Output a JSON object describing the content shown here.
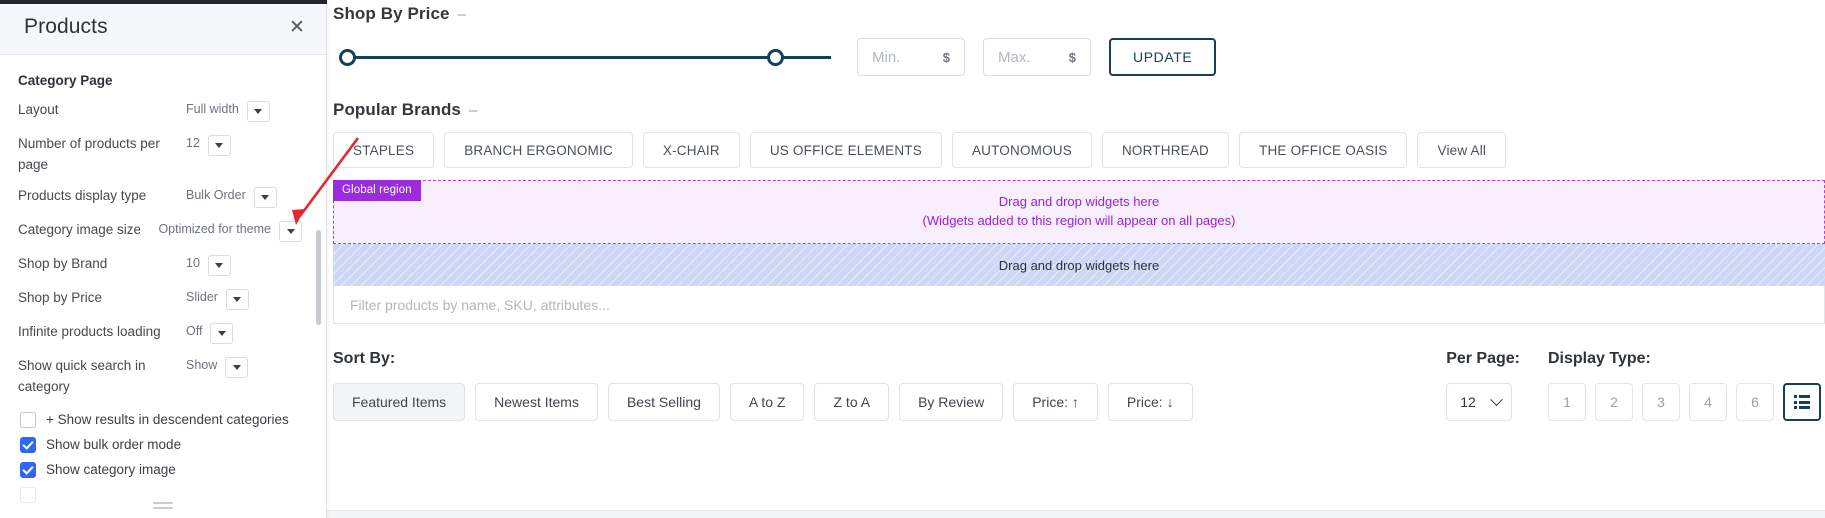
{
  "panel": {
    "title": "Products",
    "close_icon": "close-icon",
    "section_label": "Category Page",
    "settings": [
      {
        "name": "Layout",
        "value": "Full width"
      },
      {
        "name": "Number of products per page",
        "value": "12"
      },
      {
        "name": "Products display type",
        "value": "Bulk Order"
      },
      {
        "name": "Category image size",
        "value": "Optimized for theme"
      },
      {
        "name": "Shop by Brand",
        "value": "10"
      },
      {
        "name": "Shop by Price",
        "value": "Slider"
      },
      {
        "name": "Infinite products loading",
        "value": "Off"
      },
      {
        "name": "Show quick search in category",
        "value": "Show"
      }
    ],
    "checkboxes": [
      {
        "label": "+ Show results in descendent categories",
        "checked": false
      },
      {
        "label": "Show bulk order mode",
        "checked": true
      },
      {
        "label": "Show category image",
        "checked": true
      }
    ]
  },
  "shop_by_price": {
    "title": "Shop By Price",
    "collapse_dash": "–",
    "min_placeholder": "Min.",
    "max_placeholder": "Max.",
    "currency": "$",
    "update_label": "UPDATE"
  },
  "popular_brands": {
    "title": "Popular Brands",
    "collapse_dash": "–",
    "brands": [
      "STAPLES",
      "BRANCH ERGONOMIC",
      "X-CHAIR",
      "US OFFICE ELEMENTS",
      "AUTONOMOUS",
      "NORTHREAD",
      "THE OFFICE OASIS"
    ],
    "view_all": "View All"
  },
  "regions": {
    "global_tag": "Global region",
    "global_line1": "Drag and drop widgets here",
    "global_line2": "(Widgets added to this region will appear on all pages)",
    "page_drop": "Drag and drop widgets here",
    "global_color": "#9b2bdf",
    "page_color": "#ccd8f5"
  },
  "filter": {
    "placeholder": "Filter products by name, SKU, attributes..."
  },
  "sort": {
    "label": "Sort By:",
    "options": [
      "Featured Items",
      "Newest Items",
      "Best Selling",
      "A to Z",
      "Z to A",
      "By Review",
      "Price: ↑",
      "Price: ↓"
    ],
    "active": "Featured Items"
  },
  "per_page": {
    "label": "Per Page:",
    "value": "12"
  },
  "display_type": {
    "label": "Display Type:",
    "options": [
      "1",
      "2",
      "3",
      "4",
      "6"
    ],
    "selected_icon": "list-view-icon"
  }
}
